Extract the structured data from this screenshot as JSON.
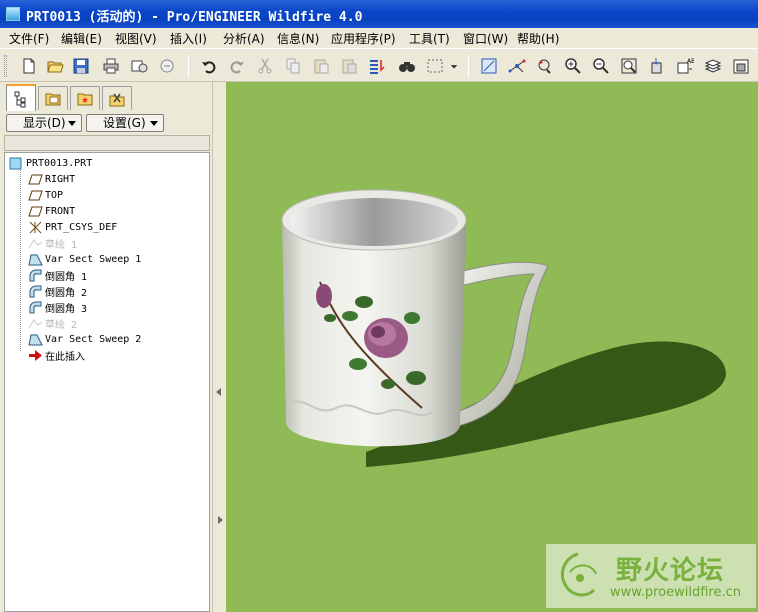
{
  "window": {
    "title": "PRT0013 (活动的) - Pro/ENGINEER Wildfire 4.0"
  },
  "menu": [
    {
      "label": "文件(F)"
    },
    {
      "label": "编辑(E)"
    },
    {
      "label": "视图(V)"
    },
    {
      "label": "插入(I)"
    },
    {
      "label": "分析(A)"
    },
    {
      "label": "信息(N)"
    },
    {
      "label": "应用程序(P)"
    },
    {
      "label": "工具(T)"
    },
    {
      "label": "窗口(W)"
    },
    {
      "label": "帮助(H)"
    }
  ],
  "toolbar": {
    "icons": [
      "new-icon",
      "open-icon",
      "save-icon",
      "print-icon",
      "send-mail-icon",
      "mail-icon",
      "undo-icon",
      "redo-icon",
      "cut-icon",
      "copy-icon",
      "paste-icon",
      "paste-special-icon",
      "regenerate-icon",
      "find-icon",
      "select-box-icon",
      "repaint-icon",
      "spin-center-icon",
      "orient-icon",
      "zoom-in-icon",
      "zoom-out-icon",
      "refit-icon",
      "saved-views-icon",
      "named-views-icon",
      "layers-icon",
      "view-manager-icon"
    ]
  },
  "navigator": {
    "tabs": [
      "model-tree-tab-icon",
      "folder-browser-tab-icon",
      "favorites-tab-icon",
      "connections-tab-icon"
    ],
    "display_label": "显示(D)",
    "settings_label": "设置(G)"
  },
  "model_tree": {
    "items": [
      {
        "label": "PRT0013.PRT",
        "icon": "part-icon",
        "dim": false
      },
      {
        "label": "RIGHT",
        "icon": "datum-plane-icon",
        "dim": false
      },
      {
        "label": "TOP",
        "icon": "datum-plane-icon",
        "dim": false
      },
      {
        "label": "FRONT",
        "icon": "datum-plane-icon",
        "dim": false
      },
      {
        "label": "PRT_CSYS_DEF",
        "icon": "csys-icon",
        "dim": false
      },
      {
        "label": "草绘 1",
        "icon": "sketch-icon",
        "dim": true
      },
      {
        "label": "Var Sect Sweep 1",
        "icon": "sweep-icon",
        "dim": false
      },
      {
        "label": "倒圆角 1",
        "icon": "round-icon",
        "dim": false
      },
      {
        "label": "倒圆角 2",
        "icon": "round-icon",
        "dim": false
      },
      {
        "label": "倒圆角 3",
        "icon": "round-icon",
        "dim": false
      },
      {
        "label": "草绘 2",
        "icon": "sketch-icon",
        "dim": true
      },
      {
        "label": "Var Sect Sweep 2",
        "icon": "sweep-icon",
        "dim": false
      },
      {
        "label": "在此插入",
        "icon": "insert-here-icon",
        "dim": false
      }
    ]
  },
  "colors": {
    "graphics_background": "#8fba55",
    "titlebar": "#0a46c8"
  },
  "watermark": {
    "text": "野火论坛",
    "url": "www.proewildfire.cn"
  }
}
